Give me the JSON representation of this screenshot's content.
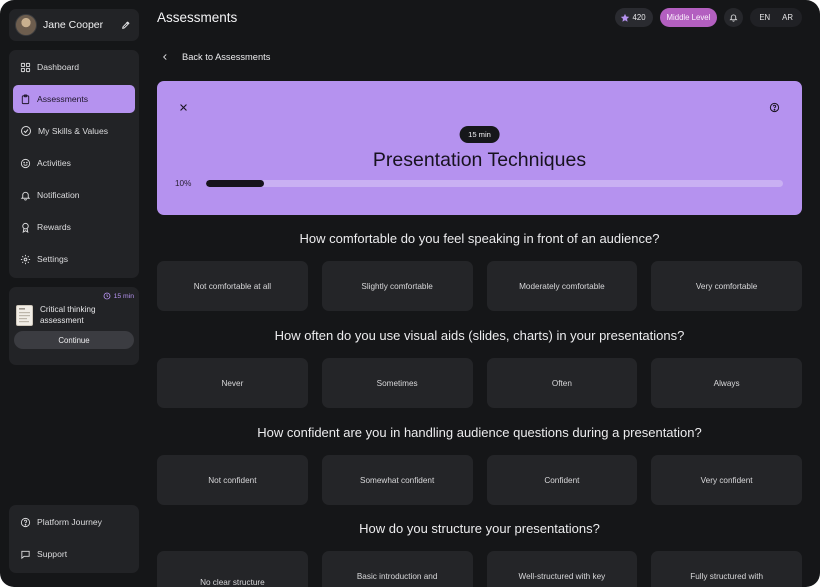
{
  "profile": {
    "name": "Jane Cooper"
  },
  "nav": [
    {
      "label": "Dashboard",
      "icon": "grid-icon",
      "active": false
    },
    {
      "label": "Assessments",
      "icon": "clipboard-icon",
      "active": true
    },
    {
      "label": "My Skills & Values",
      "icon": "check-circle-icon",
      "active": false
    },
    {
      "label": "Activities",
      "icon": "smile-icon",
      "active": false
    },
    {
      "label": "Notification",
      "icon": "bell-icon",
      "active": false
    },
    {
      "label": "Rewards",
      "icon": "award-icon",
      "active": false
    },
    {
      "label": "Settings",
      "icon": "gear-icon",
      "active": false
    }
  ],
  "pending": {
    "time": "15 min",
    "title": "Critical thinking assessment",
    "button": "Continue"
  },
  "bottom_nav": [
    {
      "label": "Platform Journey",
      "icon": "help-circle-icon"
    },
    {
      "label": "Support",
      "icon": "chat-icon"
    }
  ],
  "header": {
    "title": "Assessments",
    "points": "420",
    "level": "Middle Level",
    "languages": [
      "EN",
      "AR"
    ]
  },
  "back_label": "Back to Assessments",
  "assessment": {
    "time": "15 min",
    "title": "Presentation Techniques",
    "progress_label": "10%",
    "progress": 0.1
  },
  "questions": [
    {
      "text": "How comfortable do you feel speaking in front of an audience?",
      "options": [
        "Not comfortable at all",
        "Slightly comfortable",
        "Moderately comfortable",
        "Very comfortable"
      ]
    },
    {
      "text": "How often do you use visual aids (slides, charts) in your presentations?",
      "options": [
        "Never",
        "Sometimes",
        "Often",
        "Always"
      ]
    },
    {
      "text": "How confident are you in handling audience questions during a presentation?",
      "options": [
        "Not confident",
        "Somewhat confident",
        "Confident",
        "Very confident"
      ]
    },
    {
      "text": "How do you structure your presentations?",
      "options": [
        "No clear structure",
        "Basic introduction and",
        "Well-structured with key",
        "Fully structured with"
      ]
    }
  ],
  "colors": {
    "accent": "#b592ef",
    "level_badge": "#b35fc0",
    "background": "#151618",
    "card": "#222326"
  }
}
